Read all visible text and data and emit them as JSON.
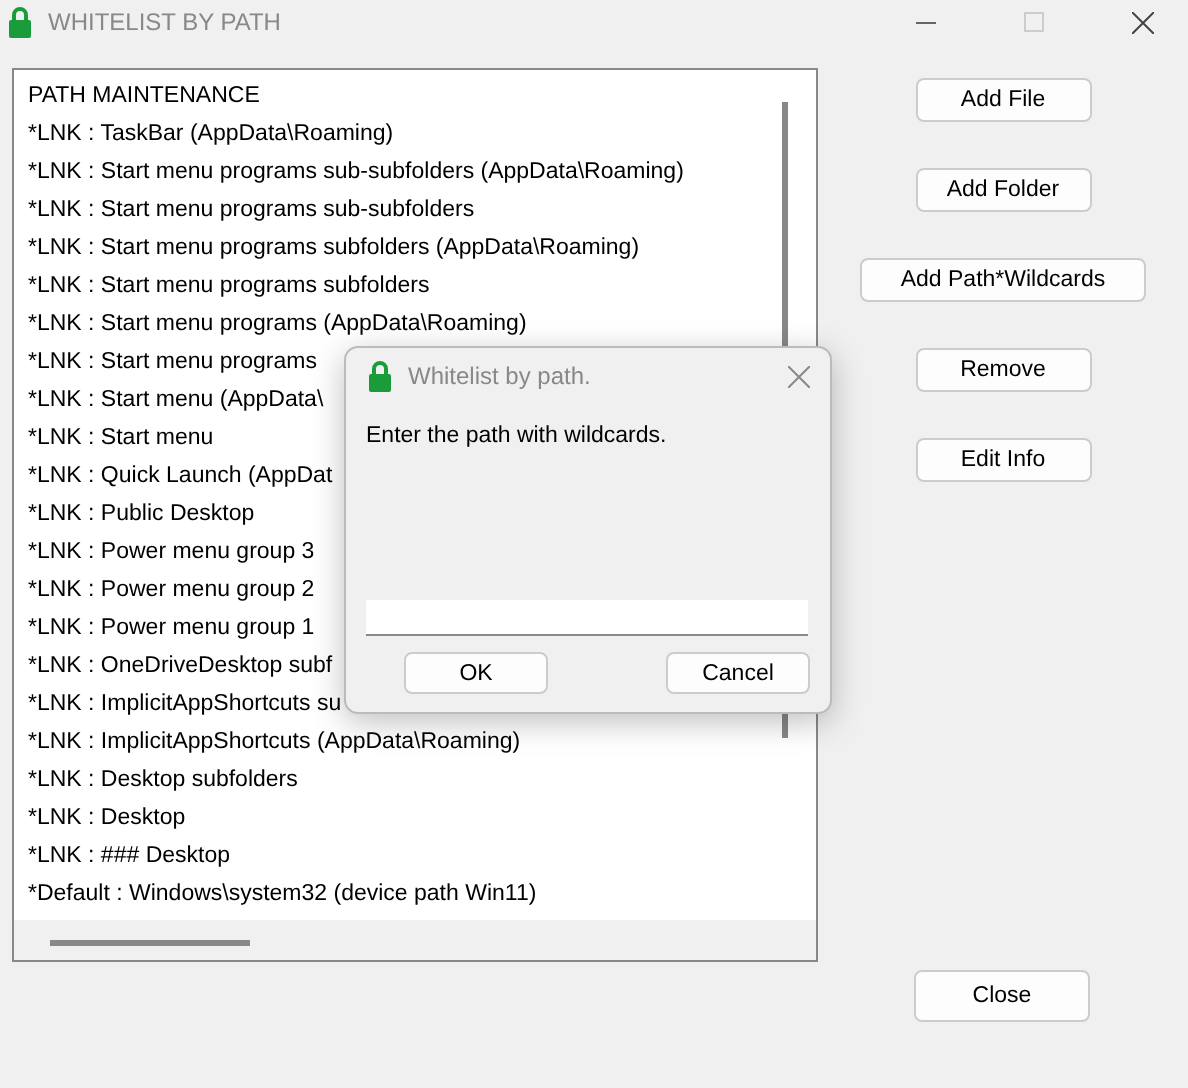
{
  "window": {
    "title": "WHITELIST BY PATH"
  },
  "list": {
    "header": "PATH MAINTENANCE",
    "items": [
      "*LNK : TaskBar (AppData\\Roaming)",
      "*LNK : Start menu programs sub-subfolders (AppData\\Roaming)",
      "*LNK : Start menu programs sub-subfolders",
      "*LNK : Start menu programs subfolders (AppData\\Roaming)",
      "*LNK : Start menu programs subfolders",
      "*LNK : Start menu programs (AppData\\Roaming)",
      "*LNK : Start menu programs",
      "*LNK : Start menu (AppData\\",
      "*LNK : Start menu",
      "*LNK : Quick Launch (AppDat",
      "*LNK : Public Desktop",
      "*LNK : Power menu group 3",
      "*LNK : Power menu group 2",
      "*LNK : Power menu group 1",
      "*LNK : OneDriveDesktop subf",
      "*LNK : ImplicitAppShortcuts su",
      "*LNK : ImplicitAppShortcuts (AppData\\Roaming)",
      "*LNK : Desktop subfolders",
      "*LNK : Desktop",
      "*LNK : ### Desktop",
      "*Default : Windows\\system32  (device path Win11)"
    ]
  },
  "buttons": [
    "Add File",
    "Add Folder",
    "Add Path*Wildcards",
    "Remove",
    "Edit Info"
  ],
  "close_button": "Close",
  "dialog": {
    "title": "Whitelist by path.",
    "prompt": "Enter the path with wildcards.",
    "buttons": [
      "OK",
      "Cancel"
    ]
  }
}
